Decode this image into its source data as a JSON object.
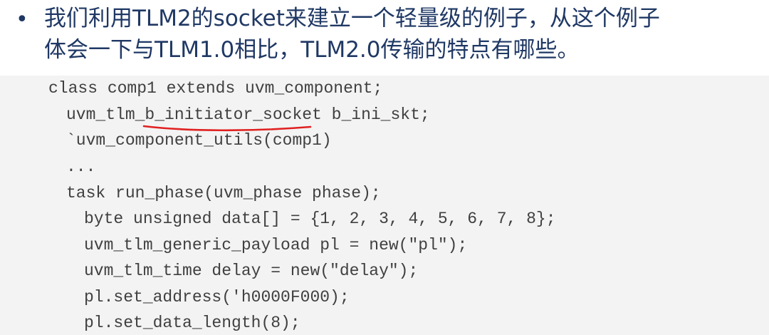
{
  "bullet": {
    "marker": "•",
    "line1": "我们利用TLM2的socket来建立一个轻量级的例子，从这个例子",
    "line2": "体会一下与TLM1.0相比，TLM2.0传输的特点有哪些。"
  },
  "code": {
    "lines": [
      "class comp1 extends uvm_component;",
      "uvm_tlm_b_initiator_socket b_ini_skt;",
      "`uvm_component_utils(comp1)",
      "...",
      "task run_phase(uvm_phase phase);",
      "byte unsigned data[] = {1, 2, 3, 4, 5, 6, 7, 8};",
      "uvm_tlm_generic_payload pl = new(\"pl\");",
      "uvm_tlm_time delay = new(\"delay\");",
      "pl.set_address('h0000F000);",
      "pl.set_data_length(8);"
    ]
  },
  "colors": {
    "bullet_text": "#1f3864",
    "code_text": "#404040",
    "code_background": "#f3f3f3",
    "annotation_underline": "#e02020"
  }
}
